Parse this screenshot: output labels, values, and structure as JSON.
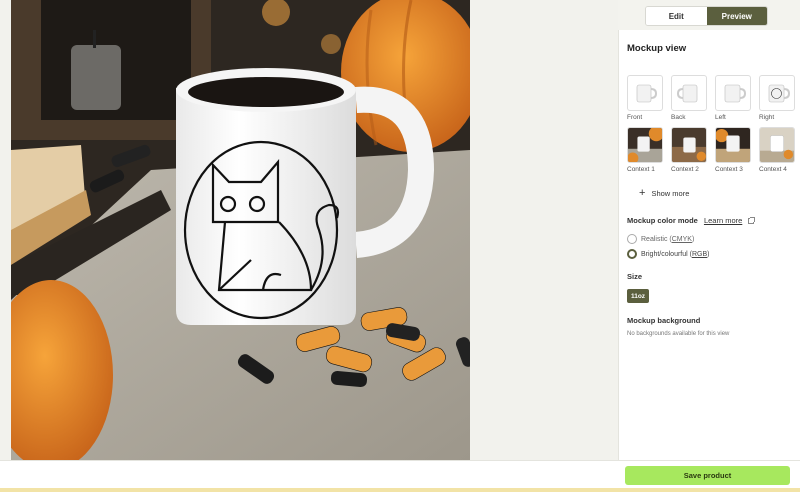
{
  "toolbar": {
    "edit_label": "Edit",
    "preview_label": "Preview"
  },
  "panel": {
    "title": "Mockup view",
    "views": [
      {
        "label": "Front",
        "icon": "mug-front-thumbnail"
      },
      {
        "label": "Back",
        "icon": "mug-back-thumbnail"
      },
      {
        "label": "Left",
        "icon": "mug-left-thumbnail"
      },
      {
        "label": "Right",
        "icon": "mug-right-thumbnail"
      },
      {
        "label": "Context 1",
        "icon": "context-photo-thumbnail"
      },
      {
        "label": "Context 2",
        "icon": "context-photo-thumbnail"
      },
      {
        "label": "Context 3",
        "icon": "context-photo-thumbnail"
      },
      {
        "label": "Context 4",
        "icon": "context-photo-thumbnail"
      }
    ],
    "show_more": "Show more",
    "color_mode": {
      "label": "Mockup color mode",
      "learn_more": "Learn more",
      "options": [
        {
          "prefix": "Realistic (",
          "code": "CMYK",
          "suffix": ")",
          "selected": false
        },
        {
          "prefix": "Bright/colourful (",
          "code": "RGB",
          "suffix": ")",
          "selected": true
        }
      ]
    },
    "size": {
      "label": "Size",
      "selected": "11oz"
    },
    "background": {
      "label": "Mockup background",
      "empty_text": "No backgrounds available for this view"
    }
  },
  "footer": {
    "save_label": "Save product"
  },
  "colors": {
    "accent_dark": "#5b5f3e",
    "save_green": "#a7e85e"
  }
}
